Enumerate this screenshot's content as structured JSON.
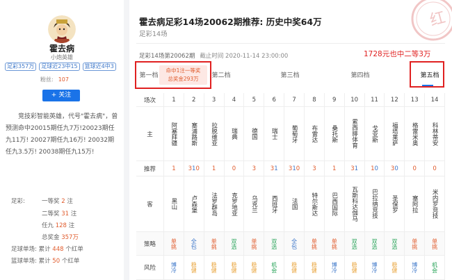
{
  "profile": {
    "name": "霍去病",
    "title": "小炮英雄",
    "badges": [
      "足彩357万",
      "足球近23中15",
      "篮球近4中3"
    ],
    "fans_label": "粉丝:",
    "fans_value": "107",
    "follow_label": "+ 关注",
    "bio": "竞技彩智能英雄，代号\"霍去病\"，曾预测命中20015期任九7万!20023期任九11万! 20027期任九16万! 20032期任九3.5万! 20038期任九15万!",
    "stats": {
      "zucai_label": "足彩:",
      "first_prize_label": "一等奖",
      "first_prize_value": "2",
      "second_prize_label": "二等奖",
      "second_prize_value": "31",
      "ren9_label": "任九",
      "ren9_value": "128",
      "total_label": "总奖金",
      "total_value": "357万",
      "unit_zhu": "注",
      "football_label": "足球单场:",
      "football_prefix": "累计",
      "football_value": "448",
      "football_suffix": "个红单",
      "basketball_label": "篮球单场:",
      "basketball_prefix": "累计",
      "basketball_value": "50",
      "basketball_suffix": "个红单"
    }
  },
  "article": {
    "title": "霍去病足彩14场20062期推荐: 历史中奖64万",
    "subtitle": "足彩14场",
    "meta_issue": "足彩14场第20062期",
    "meta_deadline": "截止时间 2020-11-14 23:00:00",
    "win_note": "1728元也中二等3万",
    "hit_line1": "命中1注一等奖",
    "hit_line2": "总奖金293万"
  },
  "tabs": [
    "第一档",
    "第二档",
    "第三档",
    "第四档",
    "第五档"
  ],
  "active_tab": "第五档",
  "table": {
    "row_labels": {
      "index": "场次",
      "home": "主",
      "rec": "推荐",
      "away": "客",
      "strategy": "策略",
      "risk": "风险"
    },
    "matches": [
      {
        "n": "1",
        "home": "阿塞拜疆",
        "rec": [
          [
            "1",
            "r"
          ]
        ],
        "away": "黑山",
        "strategy": "单挑",
        "strategy_color": "red",
        "risk": "博冷",
        "risk_color": "blue"
      },
      {
        "n": "2",
        "home": "塞浦路斯",
        "rec": [
          [
            "3",
            "r"
          ],
          [
            "1",
            "b"
          ],
          [
            "0",
            "r"
          ]
        ],
        "away": "卢森堡",
        "strategy": "全包",
        "strategy_color": "blue",
        "risk": "稳健",
        "risk_color": "orange"
      },
      {
        "n": "3",
        "home": "拉脱维亚",
        "rec": [
          [
            "1",
            "r"
          ]
        ],
        "away": "法罗群岛",
        "strategy": "单挑",
        "strategy_color": "red",
        "risk": "稳健",
        "risk_color": "orange"
      },
      {
        "n": "4",
        "home": "瑞典",
        "rec": [
          [
            "0",
            "r"
          ]
        ],
        "away": "克罗地亚",
        "strategy": "双选",
        "strategy_color": "green",
        "risk": "稳健",
        "risk_color": "orange"
      },
      {
        "n": "5",
        "home": "德国",
        "rec": [
          [
            "3",
            "r"
          ]
        ],
        "away": "乌克兰",
        "strategy": "单挑",
        "strategy_color": "red",
        "risk": "稳健",
        "risk_color": "orange"
      },
      {
        "n": "6",
        "home": "瑞士",
        "rec": [
          [
            "3",
            "r"
          ],
          [
            "1",
            "b"
          ]
        ],
        "away": "西班牙",
        "strategy": "双选",
        "strategy_color": "green",
        "risk": "机会",
        "risk_color": "green"
      },
      {
        "n": "7",
        "home": "葡萄牙",
        "rec": [
          [
            "3",
            "r"
          ],
          [
            "1",
            "b"
          ],
          [
            "0",
            "r"
          ]
        ],
        "away": "法国",
        "strategy": "全包",
        "strategy_color": "blue",
        "risk": "稳健",
        "risk_color": "orange"
      },
      {
        "n": "8",
        "home": "布雷达",
        "rec": [
          [
            "3",
            "r"
          ]
        ],
        "away": "特尔斯达",
        "strategy": "单挑",
        "strategy_color": "red",
        "risk": "稳健",
        "risk_color": "orange"
      },
      {
        "n": "9",
        "home": "桑托斯",
        "rec": [
          [
            "1",
            "r"
          ]
        ],
        "away": "巴西国际",
        "strategy": "单挑",
        "strategy_color": "red",
        "risk": "博冷",
        "risk_color": "blue"
      },
      {
        "n": "10",
        "home": "累西腓体育",
        "rec": [
          [
            "3",
            "r"
          ],
          [
            "1",
            "b"
          ]
        ],
        "away": "瓦斯科达伽马",
        "strategy": "双选",
        "strategy_color": "green",
        "risk": "稳健",
        "risk_color": "orange"
      },
      {
        "n": "11",
        "home": "戈亚斯",
        "rec": [
          [
            "1",
            "r"
          ],
          [
            "0",
            "b"
          ]
        ],
        "away": "巴拉纳竞技",
        "strategy": "双选",
        "strategy_color": "green",
        "risk": "博冷",
        "risk_color": "blue"
      },
      {
        "n": "12",
        "home": "福塔莱萨",
        "rec": [
          [
            "3",
            "r"
          ],
          [
            "0",
            "b"
          ]
        ],
        "away": "圣保罗",
        "strategy": "双选",
        "strategy_color": "green",
        "risk": "稳健",
        "risk_color": "orange"
      },
      {
        "n": "13",
        "home": "格雷米奥",
        "rec": [
          [
            "0",
            "r"
          ]
        ],
        "away": "塞阿拉",
        "strategy": "单挑",
        "strategy_color": "red",
        "risk": "博冷",
        "risk_color": "blue"
      },
      {
        "n": "14",
        "home": "科林蒂安",
        "rec": [
          [
            "0",
            "r"
          ]
        ],
        "away": "米内罗竞技",
        "strategy": "单挑",
        "strategy_color": "red",
        "risk": "机会",
        "risk_color": "green"
      }
    ]
  }
}
